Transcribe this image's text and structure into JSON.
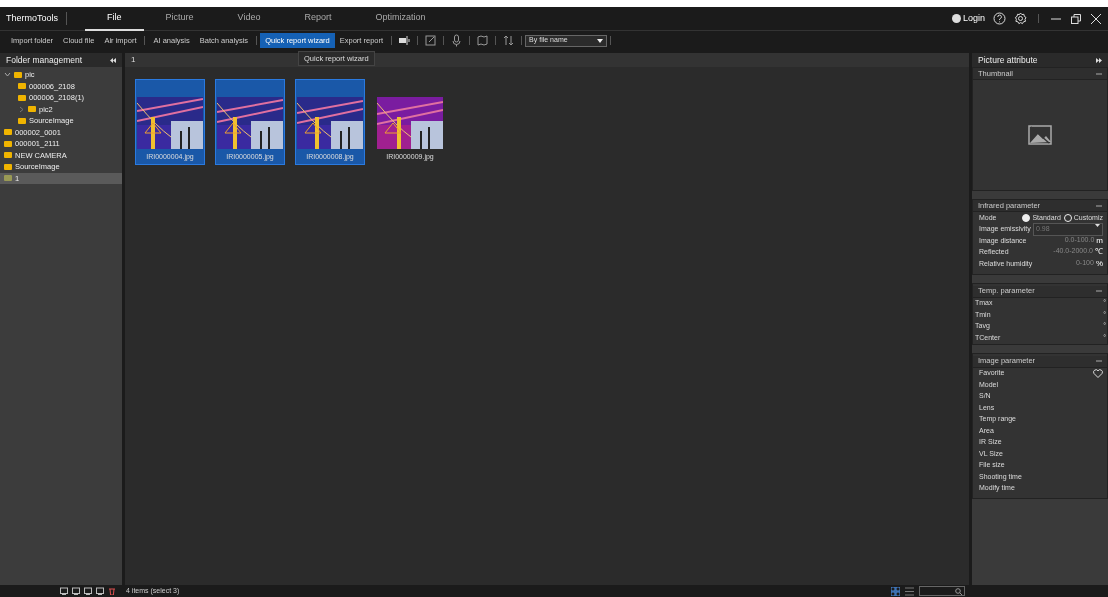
{
  "app": {
    "title": "ThermoTools"
  },
  "menu_tabs": [
    {
      "label": "File",
      "selected": true
    },
    {
      "label": "Picture",
      "selected": false
    },
    {
      "label": "Video",
      "selected": false
    },
    {
      "label": "Report",
      "selected": false
    },
    {
      "label": "Optimization",
      "selected": false
    }
  ],
  "title_bar": {
    "login": "Login"
  },
  "toolbar": {
    "groups": [
      [
        {
          "label": "Import folder",
          "selected": false
        },
        {
          "label": "Cloud file",
          "selected": false
        },
        {
          "label": "Air import",
          "selected": false
        }
      ],
      [
        {
          "label": "AI analysis",
          "selected": false
        },
        {
          "label": "Batch analysis",
          "selected": false
        }
      ],
      [
        {
          "label": "Quick report wizard",
          "selected": true
        },
        {
          "label": "Export report",
          "selected": false
        }
      ]
    ],
    "tooltip": "Quick report wizard",
    "sort": {
      "value": "By file name"
    }
  },
  "folder_panel": {
    "title": "Folder management",
    "tree": [
      {
        "label": "pic",
        "expanded": true,
        "selected": false,
        "children": [
          {
            "label": "000006_2108",
            "selected": false
          },
          {
            "label": "000006_2108(1)",
            "selected": false
          },
          {
            "label": "pic2",
            "expanded": false,
            "selected": false
          },
          {
            "label": "SourceImage",
            "selected": false
          }
        ]
      },
      {
        "label": "000002_0001",
        "selected": false
      },
      {
        "label": "000001_2111",
        "selected": false
      },
      {
        "label": "NEW CAMERA",
        "selected": false
      },
      {
        "label": "SourceImage",
        "selected": false
      },
      {
        "label": "1",
        "selected": true
      }
    ]
  },
  "gallery": {
    "path": "1",
    "files": [
      {
        "name": "IRI0000004.jpg",
        "selected": true,
        "kind": "picture"
      },
      {
        "name": "IRI0000005.jpg",
        "selected": true,
        "kind": "picture"
      },
      {
        "name": "IRI0000008.jpg",
        "selected": true,
        "kind": "picture"
      },
      {
        "name": "IRI0000009.jpg",
        "selected": false,
        "kind": "picture"
      }
    ]
  },
  "status_bar": {
    "text": "4 items (select 3)"
  },
  "attribute_panel": {
    "title": "Picture attribute",
    "thumbnail": {
      "title": "Thumbnail"
    },
    "infrared": {
      "title": "Infrared parameter",
      "mode_label": "Mode",
      "modes": [
        {
          "label": "Standard",
          "selected": true
        },
        {
          "label": "Customiz",
          "selected": false
        }
      ],
      "emissivity": {
        "label": "Image emissivity",
        "value": "0.98"
      },
      "rows": [
        {
          "label": "Image distance",
          "range": "0.0-100.0",
          "unit": "m"
        },
        {
          "label": "Reflected",
          "range": "-40.0-2000.0",
          "unit": "℃"
        },
        {
          "label": "Relative humidity",
          "range": "0-100",
          "unit": "%"
        }
      ]
    },
    "temp": {
      "title": "Temp. parameter",
      "rows": [
        {
          "label": "Tmax",
          "unit": "°"
        },
        {
          "label": "Tmin",
          "unit": "°"
        },
        {
          "label": "Tavg",
          "unit": "°"
        },
        {
          "label": "TCenter",
          "unit": "°"
        }
      ]
    },
    "image": {
      "title": "Image parameter",
      "favorite": {
        "label": "Favorite",
        "checked": false
      },
      "rows": [
        "Model",
        "S/N",
        "Lens",
        "Temp range",
        "Area",
        "IR Size",
        "VL Size",
        "File size",
        "Shooting time",
        "Modify time"
      ]
    }
  }
}
